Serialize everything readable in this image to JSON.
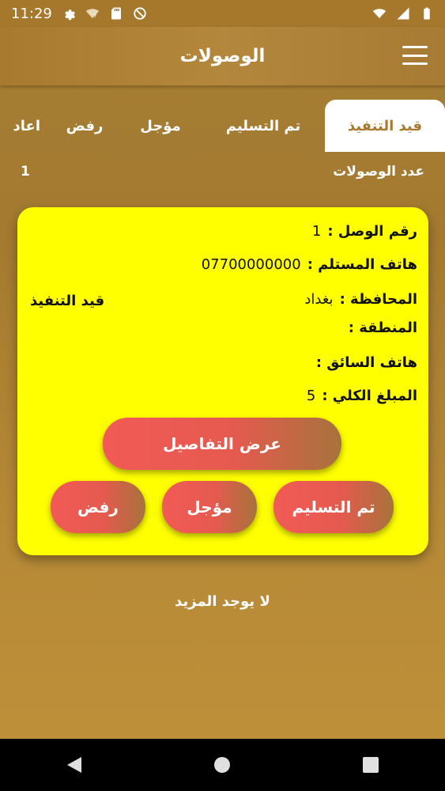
{
  "status_bar": {
    "time": "11:29",
    "icons": [
      "gear-icon",
      "wifi-question-icon",
      "sd-card-icon",
      "no-data-icon",
      "signal-icon",
      "battery-icon"
    ]
  },
  "app_bar": {
    "title": "الوصولات",
    "menu_icon": "hamburger-menu-icon"
  },
  "tabs": [
    {
      "label": "قيد التنفيذ",
      "active": true
    },
    {
      "label": "تم التسليم",
      "active": false
    },
    {
      "label": "مؤجل",
      "active": false
    },
    {
      "label": "رفض",
      "active": false
    },
    {
      "label": "اعاد",
      "active": false
    }
  ],
  "summary": {
    "label": "عدد الوصولات",
    "count": "1"
  },
  "card": {
    "receipt_label": "رقم الوصل :",
    "receipt_value": "1",
    "phone_label": "هاتف المستلم :",
    "phone_value": "07700000000",
    "province_label": "المحافظة :",
    "province_value": "بغداد",
    "status": "قيد التنفيذ",
    "area_label": "المنطقة :",
    "driver_phone_label": "هاتف السائق :",
    "total_label": "المبلغ الكلي :",
    "total_value": "5",
    "details_button": "عرض التفاصيل",
    "delivered_button": "تم التسليم",
    "postponed_button": "مؤجل",
    "reject_button": "رفض"
  },
  "footer_text": "لا يوجد المزيد",
  "colors": {
    "background": "#a67a2f",
    "card": "#ffff00",
    "button_start": "#f25a56",
    "button_end": "#a7733b"
  }
}
